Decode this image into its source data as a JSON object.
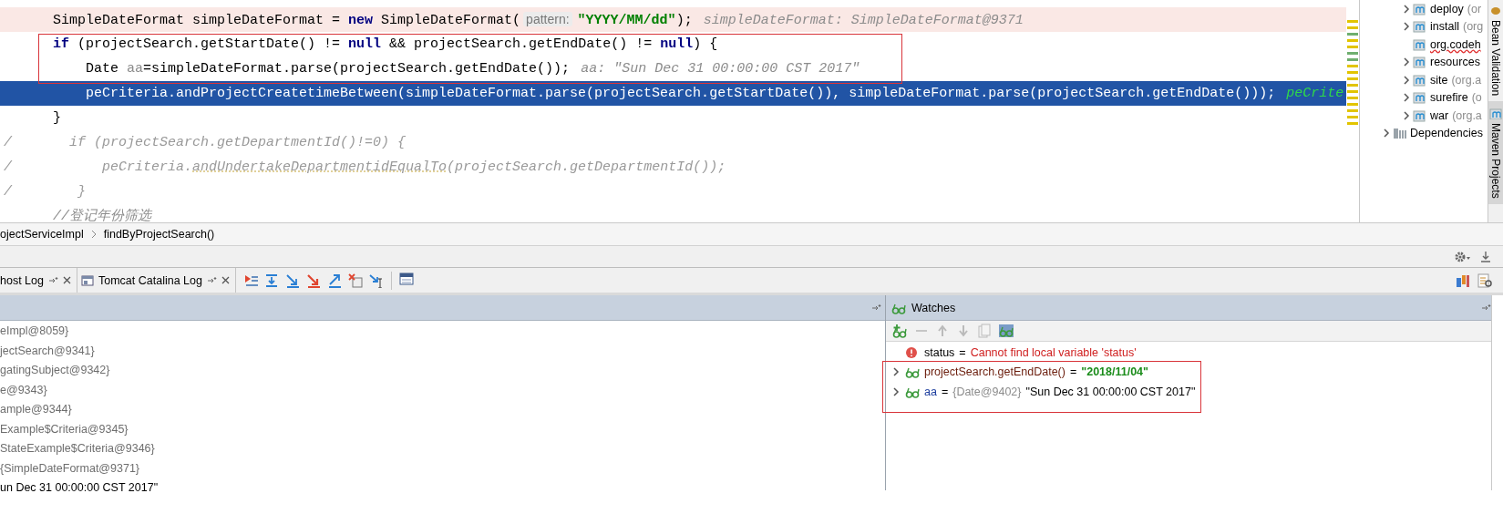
{
  "editor": {
    "lines": [
      {
        "breakpoint": true,
        "current": false,
        "segments": [
          {
            "kind": "plain",
            "text": "      SimpleDateFormat simpleDateFormat = "
          },
          {
            "kind": "keyword",
            "text": "new"
          },
          {
            "kind": "plain",
            "text": " SimpleDateFormat("
          },
          {
            "kind": "param_hint",
            "text": "pattern:"
          },
          {
            "kind": "string",
            "text": "\"YYYY/MM/dd\""
          },
          {
            "kind": "plain",
            "text": ");"
          },
          {
            "kind": "value_hint",
            "text": "simpleDateFormat: SimpleDateFormat@9371"
          }
        ]
      },
      {
        "breakpoint": false,
        "current": false,
        "marked": true,
        "segments": [
          {
            "kind": "keyword",
            "text": "      if"
          },
          {
            "kind": "plain",
            "text": " (projectSearch.getStartDate() != "
          },
          {
            "kind": "keyword",
            "text": "null"
          },
          {
            "kind": "plain",
            "text": " && projectSearch.getEndDate() != "
          },
          {
            "kind": "keyword",
            "text": "null"
          },
          {
            "kind": "plain",
            "text": ") {"
          }
        ]
      },
      {
        "breakpoint": false,
        "current": false,
        "marked": true,
        "segments": [
          {
            "kind": "plain",
            "text": "          Date "
          },
          {
            "kind": "unused",
            "text": "aa"
          },
          {
            "kind": "plain",
            "text": "=simpleDateFormat.parse(projectSearch.getEndDate());"
          },
          {
            "kind": "value_hint",
            "text": "aa: \"Sun Dec 31 00:00:00 CST 2017\""
          }
        ]
      },
      {
        "breakpoint": false,
        "current": true,
        "segments": [
          {
            "kind": "plain",
            "text": "          peCriteria.andProjectCreatetimeBetween(simpleDateFormat.parse(projectSearch.getStartDate()), simpleDateFormat.parse(projectSearch.getEndDate()));"
          },
          {
            "kind": "value_hint",
            "text": "peCrite"
          }
        ]
      },
      {
        "breakpoint": false,
        "current": false,
        "segments": [
          {
            "kind": "plain",
            "text": "      }"
          }
        ]
      },
      {
        "breakpoint": false,
        "current": false,
        "segments": [
          {
            "kind": "disabled",
            "text": "/       if (projectSearch.getDepartmentId()!=0) {"
          }
        ]
      },
      {
        "breakpoint": false,
        "current": false,
        "segments": [
          {
            "kind": "disabled",
            "text": "/           peCriteria."
          },
          {
            "kind": "disabled_underlined",
            "text": "andUndertakeDepartmentidEqualTo"
          },
          {
            "kind": "disabled",
            "text": "(projectSearch.getDepartmentId());"
          }
        ]
      },
      {
        "breakpoint": false,
        "current": false,
        "segments": [
          {
            "kind": "disabled",
            "text": "/        }"
          }
        ]
      },
      {
        "breakpoint": false,
        "current": false,
        "segments": [
          {
            "kind": "comment",
            "text": "      //登记年份筛选"
          }
        ]
      }
    ]
  },
  "project_tree": {
    "items": [
      {
        "kind": "plugin",
        "label": "deploy",
        "detail": "(or",
        "expandable": true
      },
      {
        "kind": "plugin",
        "label": "install",
        "detail": "(org",
        "expandable": true
      },
      {
        "kind": "plugin",
        "label": "org.codeh",
        "expandable": false,
        "misspelled": true
      },
      {
        "kind": "plugin",
        "label": "resources",
        "expandable": true
      },
      {
        "kind": "plugin",
        "label": "site",
        "detail": "(org.a",
        "expandable": true
      },
      {
        "kind": "plugin",
        "label": "surefire",
        "detail": "(o",
        "expandable": true
      },
      {
        "kind": "plugin",
        "label": "war",
        "detail": "(org.a",
        "expandable": true
      },
      {
        "kind": "folder",
        "label": "Dependencies",
        "expandable": true
      }
    ]
  },
  "side_tabs": [
    {
      "label": "Bean Validation",
      "selected": false
    },
    {
      "label": "Maven Projects",
      "selected": true
    }
  ],
  "breadcrumb": [
    "ojectServiceImpl",
    "findByProjectSearch()"
  ],
  "tool_tabs": [
    {
      "label": "host Log",
      "has_icon": false
    },
    {
      "label": "Tomcat Catalina Log",
      "has_icon": true
    }
  ],
  "variables": {
    "rows": [
      {
        "kind": "object",
        "text": "eImpl@8059}"
      },
      {
        "kind": "object",
        "text": "jectSearch@9341}"
      },
      {
        "kind": "object",
        "text": "gatingSubject@9342}"
      },
      {
        "kind": "object",
        "text": "e@9343}"
      },
      {
        "kind": "object",
        "text": "ample@9344}"
      },
      {
        "kind": "object",
        "text": "Example$Criteria@9345}"
      },
      {
        "kind": "object",
        "text": "StateExample$Criteria@9346}"
      },
      {
        "kind": "object",
        "text": "{SimpleDateFormat@9371}"
      },
      {
        "kind": "string",
        "text": "un Dec 31 00:00:00 CST 2017\""
      }
    ]
  },
  "watches": {
    "title": "Watches",
    "items": [
      {
        "kind": "error",
        "name": "status",
        "operator": "=",
        "value": "Cannot find local variable 'status'",
        "expandable": false
      },
      {
        "kind": "value",
        "name": "projectSearch.getEndDate()",
        "operator": "=",
        "value": "\"2018/11/04\"",
        "expandable": true,
        "marked": true
      },
      {
        "kind": "object",
        "name": "aa",
        "operator": "=",
        "type": "{Date@9402}",
        "value": "\"Sun Dec 31 00:00:00 CST 2017\"",
        "expandable": true,
        "marked": true
      }
    ]
  }
}
